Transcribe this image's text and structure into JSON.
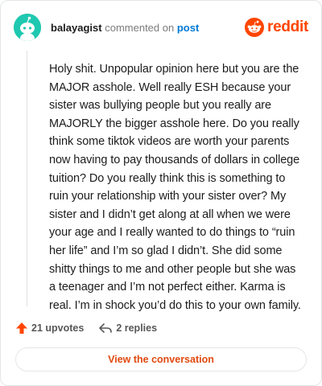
{
  "header": {
    "username": "balayagist",
    "verb": "commented on",
    "post_link": "post",
    "brand_name": "reddit"
  },
  "comment": {
    "body": "Holy shit. Unpopular opinion here but you are the MAJOR asshole. Well really ESH because your sister was bullying people but you really are MAJORLY the bigger asshole here. Do you really think some tiktok videos are worth your parents now having to pay thousands of dollars in college tuition? Do you really think this is something to ruin your relationship with your sister over? My sister and I didn’t get along at all when we were your age and I really wanted to do things to “ruin her life” and I’m so glad I didn’t. She did some shitty things to me and other people but she was a teenager and I’m not perfect either. Karma is real. I’m in shock you’d do this to your own family."
  },
  "actions": {
    "upvotes_label": "21 upvotes",
    "replies_label": "2 replies"
  },
  "view_button_label": "View the conversation",
  "colors": {
    "brand": "#ff4500",
    "avatar_bg": "#1fc8b0",
    "link": "#0079d3",
    "upvote": "#ff4500",
    "button_text": "#e0490f"
  },
  "icons": {
    "avatar": "snoo-avatar-icon",
    "brand": "reddit-snoo-icon",
    "upvote": "upvote-arrow-icon",
    "reply": "reply-arrow-icon"
  }
}
